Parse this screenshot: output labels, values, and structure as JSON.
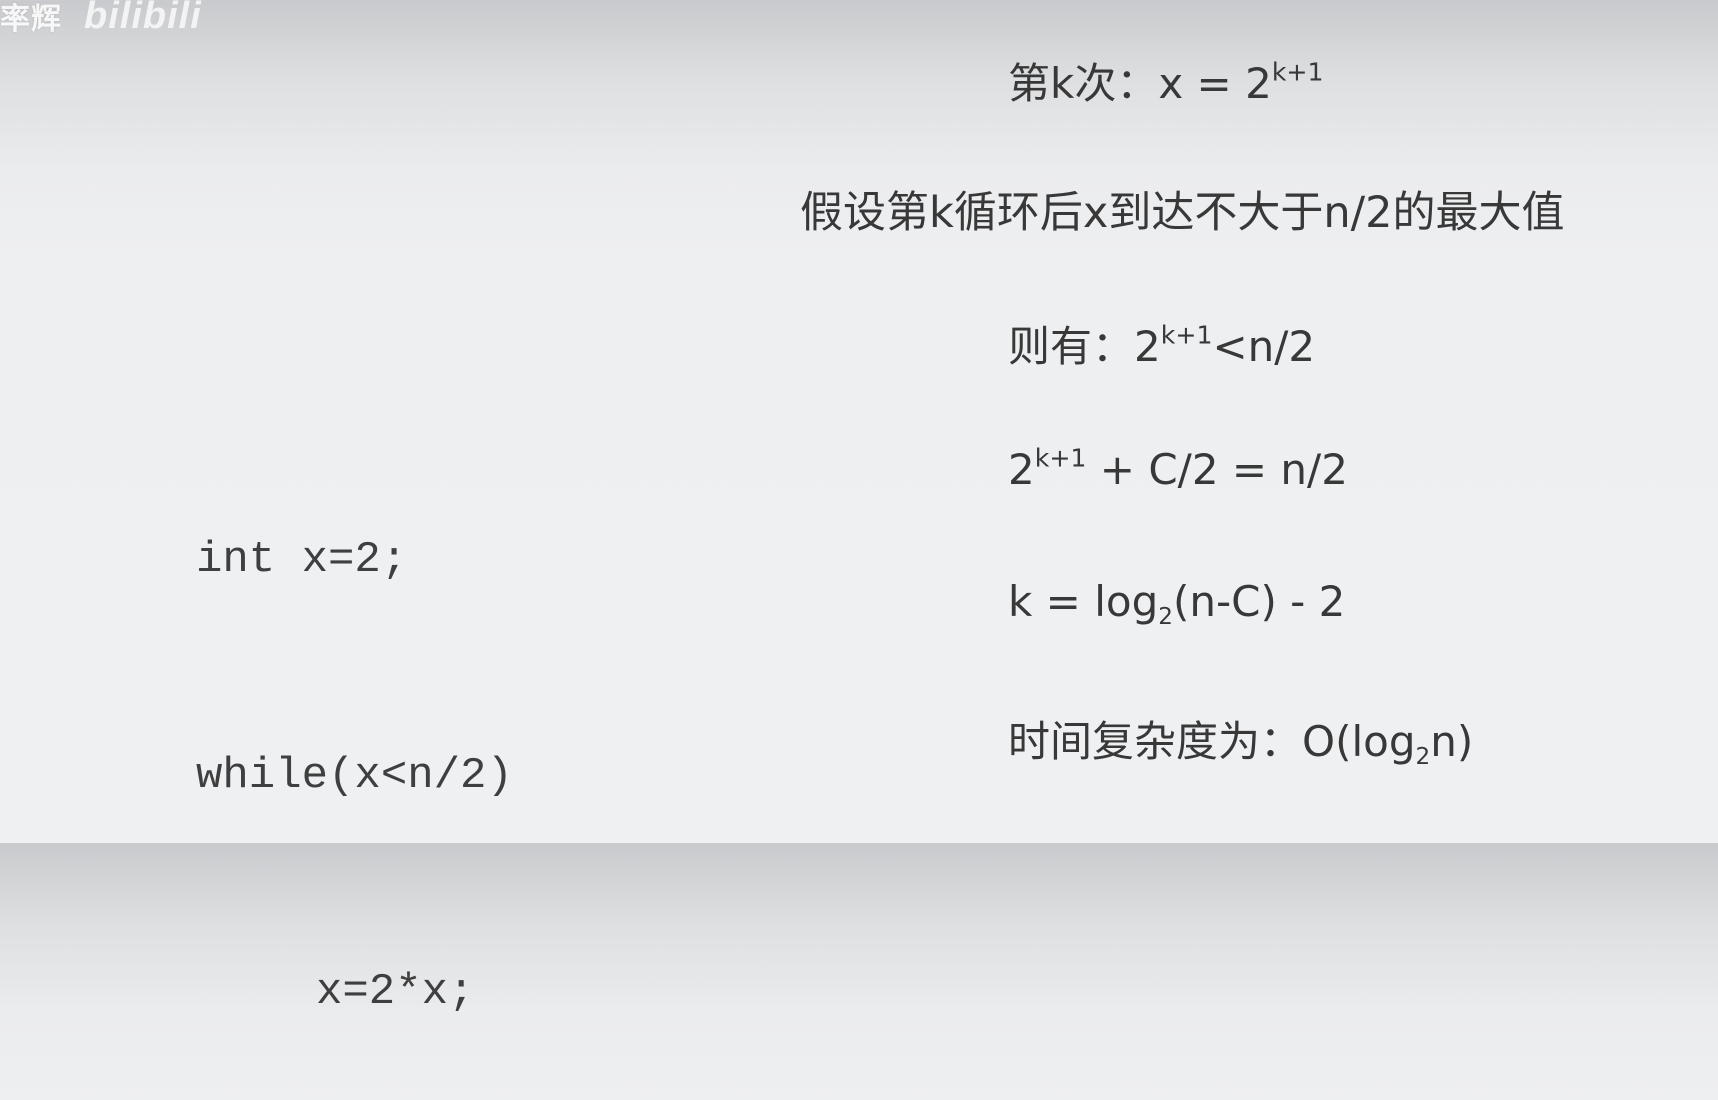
{
  "watermark": {
    "uploader": "率辉",
    "site_logo": "bilibili"
  },
  "code": {
    "lines": [
      "int x=2;",
      "while(x<n/2)",
      "x=2*x;"
    ]
  },
  "derivation": {
    "step1": {
      "label": "第k次：",
      "expr": "x = 2",
      "sup": "k+1"
    },
    "step2": {
      "text": "假设第k循环后x到达不大于n/2的最大值"
    },
    "step3": {
      "label": "则有：",
      "base": "2",
      "sup": "k+1",
      "rest": "<n/2"
    },
    "step4": {
      "base": "2",
      "sup": "k+1",
      "rest": " + C/2 = n/2"
    },
    "step5": {
      "pre": "k = log",
      "sub": "2",
      "post": "(n-C) - 2"
    },
    "step6": {
      "label": "时间复杂度为：",
      "pre": "O(log",
      "sub": "2",
      "post": "n)"
    }
  }
}
